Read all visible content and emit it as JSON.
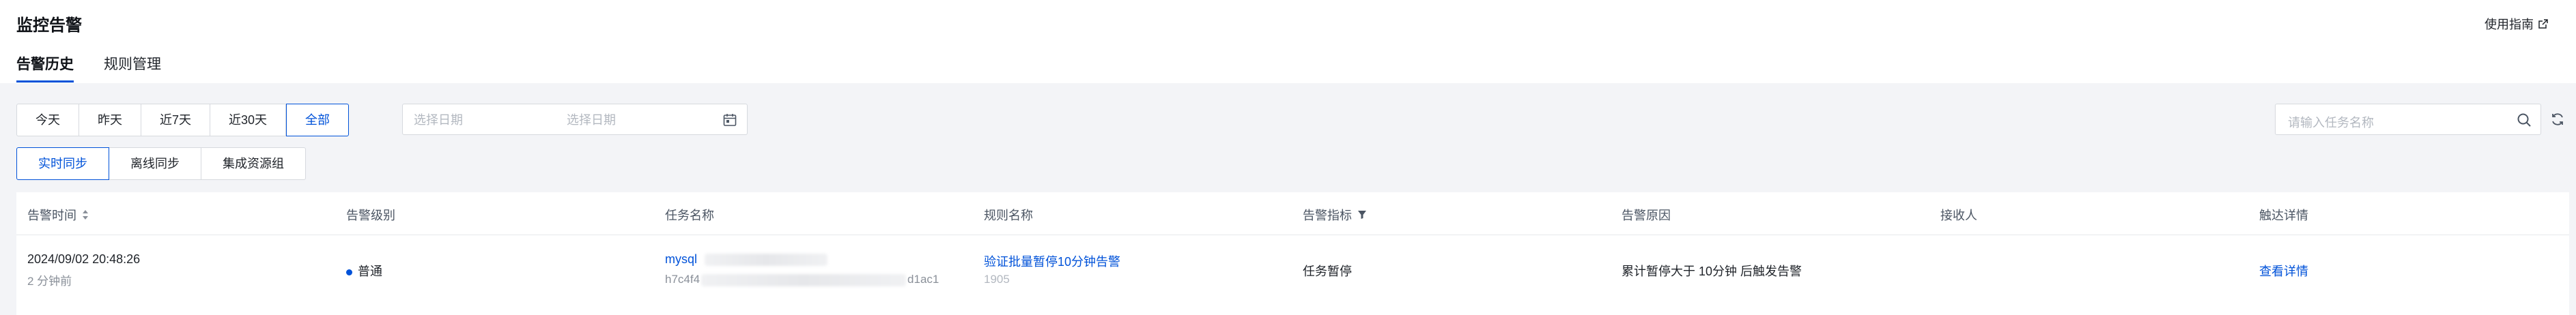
{
  "header": {
    "title": "监控告警",
    "guide_label": "使用指南",
    "tabs": [
      {
        "label": "告警历史",
        "active": true
      },
      {
        "label": "规则管理",
        "active": false
      }
    ]
  },
  "filters": {
    "date_quick": [
      {
        "label": "今天"
      },
      {
        "label": "昨天"
      },
      {
        "label": "近7天"
      },
      {
        "label": "近30天"
      },
      {
        "label": "全部",
        "active": true
      }
    ],
    "date_start_placeholder": "选择日期",
    "date_end_placeholder": "选择日期",
    "search_placeholder": "请输入任务名称",
    "sync_types": [
      {
        "label": "实时同步",
        "active": true
      },
      {
        "label": "离线同步"
      },
      {
        "label": "集成资源组"
      }
    ]
  },
  "table": {
    "columns": [
      "告警时间",
      "告警级别",
      "任务名称",
      "规则名称",
      "告警指标",
      "告警原因",
      "接收人",
      "触达详情"
    ],
    "rows": [
      {
        "time": "2024/09/02 20:48:26",
        "time_ago": "2 分钟前",
        "level": "普通",
        "task_name": "mysql",
        "task_id_prefix": "h7c4f4",
        "task_id_suffix": "d1ac1",
        "rule_name": "验证批量暂停10分钟告警",
        "rule_id": "1905",
        "metric": "任务暂停",
        "reason": "累计暂停大于 10分钟 后触发告警",
        "receiver": "",
        "detail_label": "查看详情"
      }
    ]
  },
  "colors": {
    "accent": "#0052d9",
    "background": "#f3f4f7"
  }
}
